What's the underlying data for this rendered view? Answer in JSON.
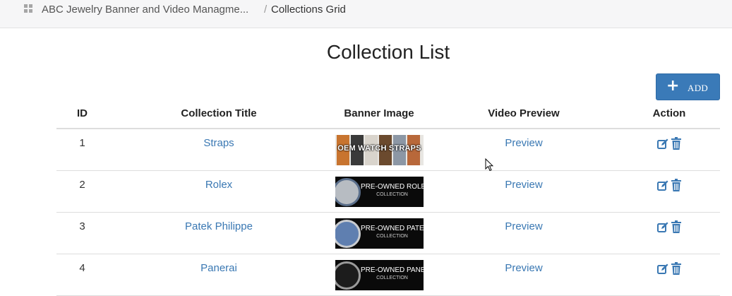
{
  "breadcrumb": {
    "app_name": "ABC Jewelry Banner and Video Managme...",
    "separator": "/",
    "current": "Collections Grid"
  },
  "page_title": "Collection List",
  "add_button": {
    "icon": "plus-icon",
    "label": "ADD"
  },
  "table": {
    "headers": [
      "ID",
      "Collection Title",
      "Banner Image",
      "Video Preview",
      "Action"
    ],
    "rows": [
      {
        "id": "1",
        "title": "Straps",
        "banner_text": "OEM WATCH STRAPS",
        "preview": "Preview"
      },
      {
        "id": "2",
        "title": "Rolex",
        "banner_text": "PRE-OWNED ROLEX",
        "banner_sub": "COLLECTION",
        "preview": "Preview"
      },
      {
        "id": "3",
        "title": "Patek Philippe",
        "banner_text": "PRE-OWNED PATEK",
        "banner_sub": "COLLECTION",
        "preview": "Preview"
      },
      {
        "id": "4",
        "title": "Panerai",
        "banner_text": "PRE-OWNED PANERAI",
        "banner_sub": "COLLECTION",
        "preview": "Preview"
      }
    ],
    "action_icons": [
      "edit-icon",
      "trash-icon"
    ]
  },
  "colors": {
    "accent": "#3a7ab8",
    "link": "#3a78b3",
    "topbar": "#f6f6f7"
  }
}
